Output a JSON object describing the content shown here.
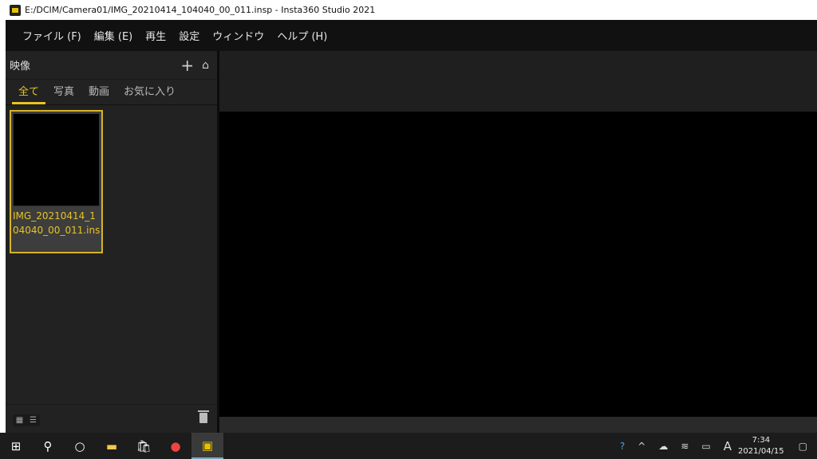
{
  "window": {
    "title": "E:/DCIM/Camera01/IMG_20210414_104040_00_011.insp - Insta360 Studio 2021"
  },
  "menu": [
    "ファイル (F)",
    "編集 (E)",
    "再生",
    "設定",
    "ウィンドウ",
    "ヘルプ (H)"
  ],
  "media_panel": {
    "title": "映像",
    "tabs": [
      "全て",
      "写真",
      "動画",
      "お気に入り"
    ],
    "active_tab": 0,
    "items": [
      {
        "name": "IMG_20210414_104040_00_011.ins"
      }
    ]
  },
  "taskbar": {
    "time": "7:34",
    "date": "2021/04/15",
    "ime": "A"
  },
  "colors": {
    "accent": "#e6c420"
  }
}
